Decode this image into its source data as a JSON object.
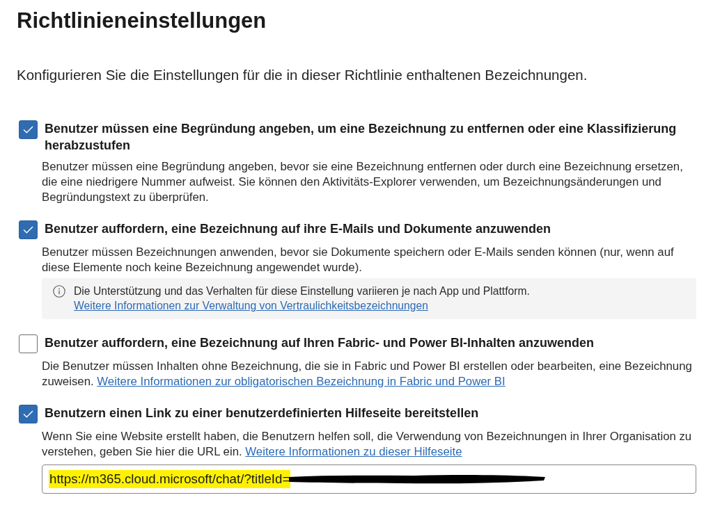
{
  "title": "Richtlinieneinstellungen",
  "intro": "Konfigurieren Sie die Einstellungen für die in dieser Richtlinie enthaltenen Bezeichnungen.",
  "settings": [
    {
      "label": "Benutzer müssen eine Begründung angeben, um eine Bezeichnung zu entfernen oder eine Klassifizierung herabzustufen",
      "checked": true,
      "description": "Benutzer müssen eine Begründung angeben, bevor sie eine Bezeichnung entfernen oder durch eine Bezeichnung ersetzen, die eine niedrigere Nummer aufweist. Sie können den Aktivitäts-Explorer verwenden, um Bezeichnungsänderungen und Begründungstext zu überprüfen."
    },
    {
      "label": "Benutzer auffordern, eine Bezeichnung auf ihre E-Mails und Dokumente anzuwenden",
      "checked": true,
      "description": "Benutzer müssen Bezeichnungen anwenden, bevor sie Dokumente speichern oder E-Mails senden können (nur, wenn auf diese Elemente noch keine Bezeichnung angewendet wurde).",
      "note": {
        "text": "Die Unterstützung und das Verhalten für diese Einstellung variieren je nach App und Plattform.",
        "link": "Weitere Informationen zur Verwaltung von Vertraulichkeitsbezeichnungen"
      }
    },
    {
      "label": "Benutzer auffordern, eine Bezeichnung auf Ihren Fabric- und Power BI-Inhalten anzuwenden",
      "checked": false,
      "description": "Die Benutzer müssen Inhalten ohne Bezeichnung, die sie in Fabric und Power BI erstellen oder bearbeiten, eine Bezeichnung zuweisen.",
      "link": "Weitere Informationen zur obligatorischen Bezeichnung in Fabric und Power BI"
    },
    {
      "label": "Benutzern einen Link zu einer benutzerdefinierten Hilfeseite bereitstellen",
      "checked": true,
      "description": "Wenn Sie eine Website erstellt haben, die Benutzern helfen soll, die Verwendung von Bezeichnungen in Ihrer Organisation zu verstehen, geben Sie hier die URL ein.",
      "link": "Weitere Informationen zu dieser Hilfeseite",
      "field": {
        "value": "https://m365.cloud.microsoft/chat/?titleId=",
        "highlighted": true,
        "redacted": true
      }
    }
  ]
}
